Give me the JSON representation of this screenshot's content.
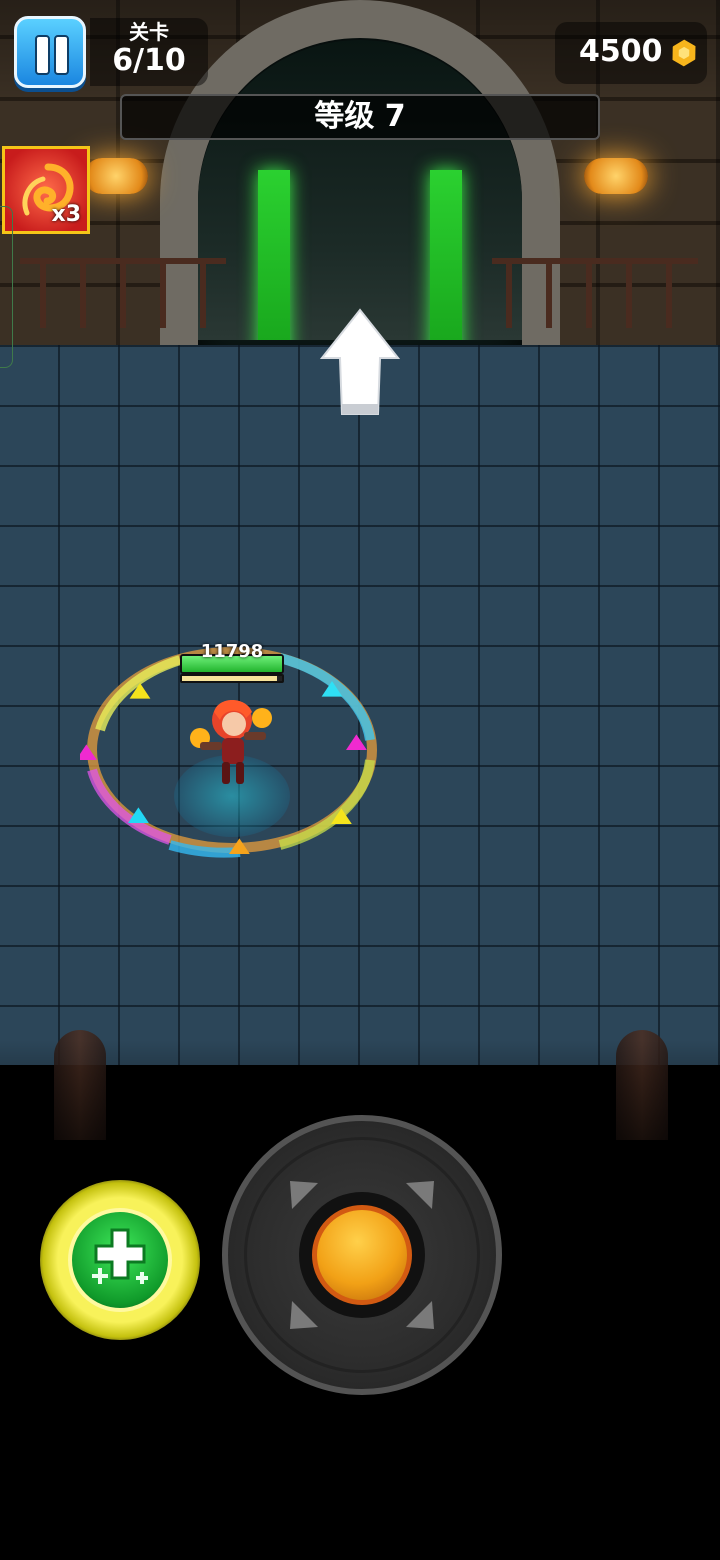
{
  "hud": {
    "level_label": "关卡",
    "level_progress": "6/10",
    "coins": "4500",
    "stage_title": "等级 7"
  },
  "skill": {
    "icon": "fire-swirl-icon",
    "multiplier": "x3"
  },
  "player": {
    "hp": "11798",
    "hp_fraction": 1.0,
    "xp_fraction": 0.95
  },
  "colors": {
    "pause_button": "#1b86e0",
    "health_bar": "#22b42e",
    "coin": "#f7b51c",
    "heal_button": "#f8f25a",
    "joystick_knob": "#f2a116"
  },
  "controls": {
    "heal_icon": "heal-plus-icon",
    "joystick_icon": "joystick-icon"
  }
}
